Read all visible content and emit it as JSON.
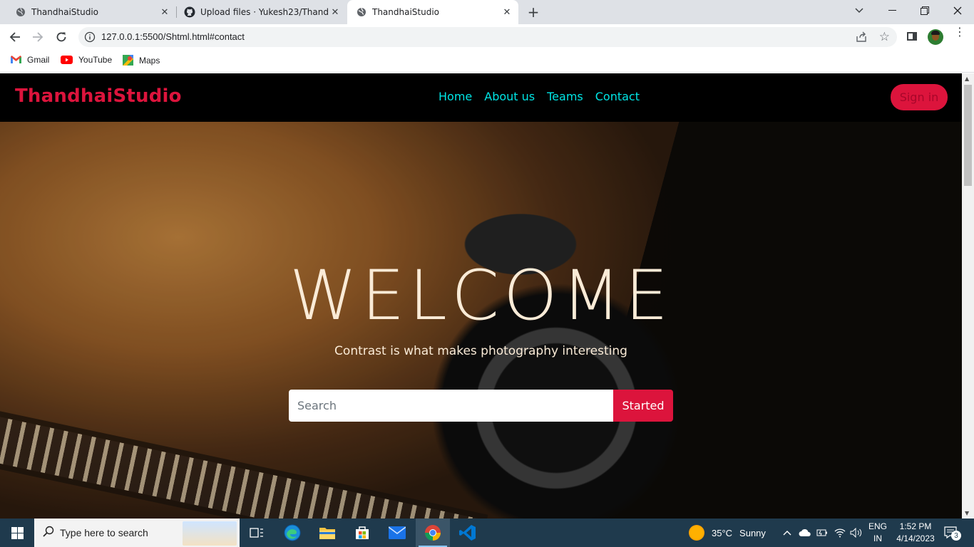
{
  "browser": {
    "tabs": [
      {
        "title": "ThandhaiStudio",
        "active": false,
        "icon": "globe-icon"
      },
      {
        "title": "Upload files · Yukesh23/Thandhai",
        "active": false,
        "icon": "github-icon"
      },
      {
        "title": "ThandhaiStudio",
        "active": true,
        "icon": "globe-icon"
      }
    ],
    "address": "127.0.0.1:5500/Shtml.html#contact",
    "bookmarks": [
      {
        "label": "Gmail",
        "icon": "gmail-icon"
      },
      {
        "label": "YouTube",
        "icon": "youtube-icon"
      },
      {
        "label": "Maps",
        "icon": "maps-icon"
      }
    ]
  },
  "site": {
    "brand": "ThandhaiStudio",
    "nav": [
      "Home",
      "About us",
      "Teams",
      "Contact"
    ],
    "signin": "Sign in",
    "hero": {
      "heading": "WELCOME",
      "tagline": "Contrast is what makes photography interesting",
      "search_placeholder": "Search",
      "button": "Started"
    },
    "colors": {
      "accent": "#dc143c",
      "nav_link": "#00e5e5",
      "hero_text": "#faebd7",
      "nav_bg": "#000000"
    }
  },
  "taskbar": {
    "search_placeholder": "Type here to search",
    "weather": {
      "temp": "35°C",
      "condition": "Sunny"
    },
    "lang": [
      "ENG",
      "IN"
    ],
    "time": "1:52 PM",
    "date": "4/14/2023",
    "notifications": "3"
  }
}
